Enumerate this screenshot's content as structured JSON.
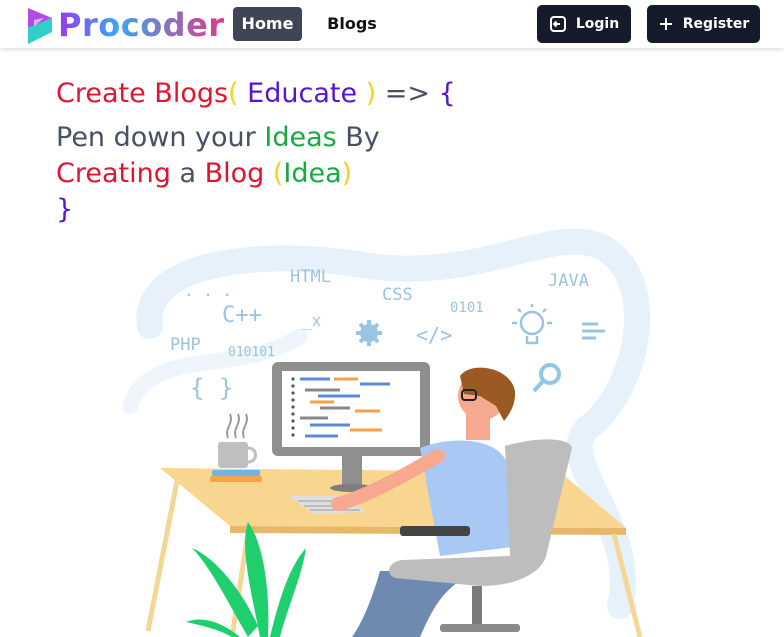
{
  "brand": {
    "name": "Procoder"
  },
  "nav": {
    "home": "Home",
    "blogs": "Blogs",
    "login": "Login",
    "register": "Register"
  },
  "hero": {
    "line1": {
      "a": "Create Blogs",
      "b": "(",
      "c": " Educate ",
      "d": ")",
      "e": " => ",
      "f": "{"
    },
    "line2": {
      "a": "Pen down your ",
      "b": "Ideas",
      "c": " By"
    },
    "line3": {
      "a": "Creating",
      "b": " a ",
      "c": "Blog",
      "d": " (",
      "e": "Idea",
      "f": ")"
    },
    "line4": "}"
  },
  "illustration": {
    "labels": {
      "html": "HTML",
      "css": "CSS",
      "java": "JAVA",
      "cpp": "C++",
      "php": "PHP",
      "bin1": "010101",
      "bin2": "0101",
      "tag": "</>",
      "braces": "{ }",
      "dash": "_x",
      "dots": ". . ."
    }
  },
  "colors": {
    "red": "#e3142e",
    "purple": "#5714d6",
    "yellow": "#f7d21e",
    "gray": "#485063",
    "green": "#16ab42",
    "navy": "#151b2b"
  }
}
